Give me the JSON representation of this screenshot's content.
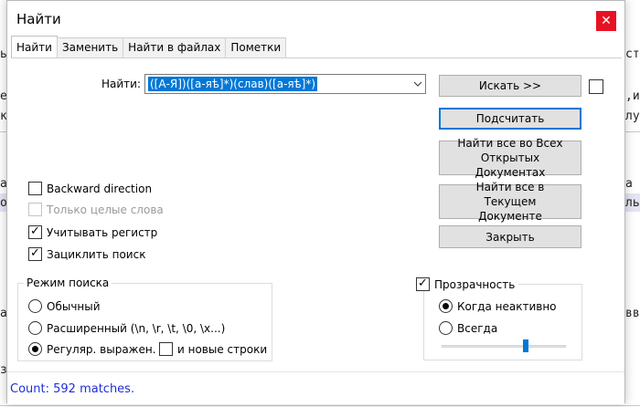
{
  "background": {
    "fragments": [
      "ь",
      "е",
      "к",
      "ар",
      "ор",
      "а",
      "зв",
      "сть",
      ",и",
      "луд",
      "а с",
      "ль",
      "вва"
    ]
  },
  "dialog": {
    "title": "Найти",
    "close_glyph": "✕",
    "tabs": [
      {
        "label": "Найти",
        "active": true
      },
      {
        "label": "Заменить",
        "active": false
      },
      {
        "label": "Найти в файлах",
        "active": false
      },
      {
        "label": "Пометки",
        "active": false
      }
    ],
    "find": {
      "label": "Найти:",
      "value": "([А-Я])([а-яѣ]*)(слав)([а-яѣ]*)",
      "dropdown_icon": "chevron-down-icon"
    },
    "buttons": {
      "search": "Искать >>",
      "count": "Подсчитать",
      "find_all_open": "Найти все во Всех Открытых Документах",
      "find_all_current": "Найти все в Текущем Документе",
      "close": "Закрыть"
    },
    "options": [
      {
        "label": "Backward direction",
        "checked": false,
        "disabled": false
      },
      {
        "label": "Только целые слова",
        "checked": false,
        "disabled": true
      },
      {
        "label": "Учитывать регистр",
        "checked": true,
        "disabled": false
      },
      {
        "label": "Зациклить поиск",
        "checked": true,
        "disabled": false
      }
    ],
    "search_mode": {
      "label": "Режим поиска",
      "modes": [
        {
          "label": "Обычный",
          "selected": false
        },
        {
          "label": "Расширенный (\\n, \\r, \\t, \\0, \\x...)",
          "selected": false
        },
        {
          "label": "Регуляр. выражен.",
          "selected": true
        }
      ],
      "newlines_label": "и новые строки",
      "newlines_checked": false
    },
    "transparency": {
      "label": "Прозрачность",
      "checked": true,
      "modes": [
        {
          "label": "Когда неактивно",
          "selected": true
        },
        {
          "label": "Всегда",
          "selected": false
        }
      ],
      "level": 0.68
    },
    "status": "Count: 592 matches.",
    "colors": {
      "accent": "#0078d7",
      "status_text": "#1f2ed8",
      "close_button": "#e81123"
    }
  }
}
